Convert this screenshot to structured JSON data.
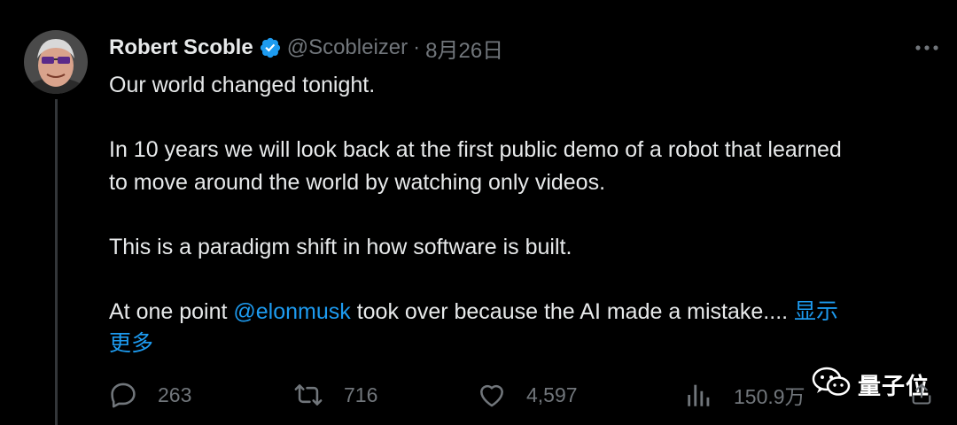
{
  "tweet": {
    "author_name": "Robert Scoble",
    "handle": "@Scobleizer",
    "separator": "·",
    "date": "8月26日",
    "line1": "Our world changed tonight.",
    "line2a": "In 10 years we will look back at the first public demo of a robot that learned",
    "line2b": "to move around the world by watching only videos.",
    "line3": "This is a paradigm shift in how software is built.",
    "line4_prefix": "At one point ",
    "mention": "@elonmusk",
    "line4_suffix": " took over because the AI made a mistake.... ",
    "show_more_1": "显示",
    "show_more_2": "更多"
  },
  "actions": {
    "replies": "263",
    "retweets": "716",
    "likes": "4,597",
    "views": "150.9万"
  },
  "watermark": {
    "text": "量子位"
  },
  "icons": {
    "verified": "verified-badge-icon",
    "more": "more-horizontal-icon",
    "reply": "reply-icon",
    "retweet": "retweet-icon",
    "like": "heart-icon",
    "views": "views-icon",
    "share": "share-icon",
    "watermark_logo": "wechat-icon"
  },
  "colors": {
    "background": "#000000",
    "text": "#e7e9ea",
    "muted": "#71767b",
    "link": "#1d9bf0",
    "verified": "#1d9bf0",
    "thread_line": "#333639"
  }
}
